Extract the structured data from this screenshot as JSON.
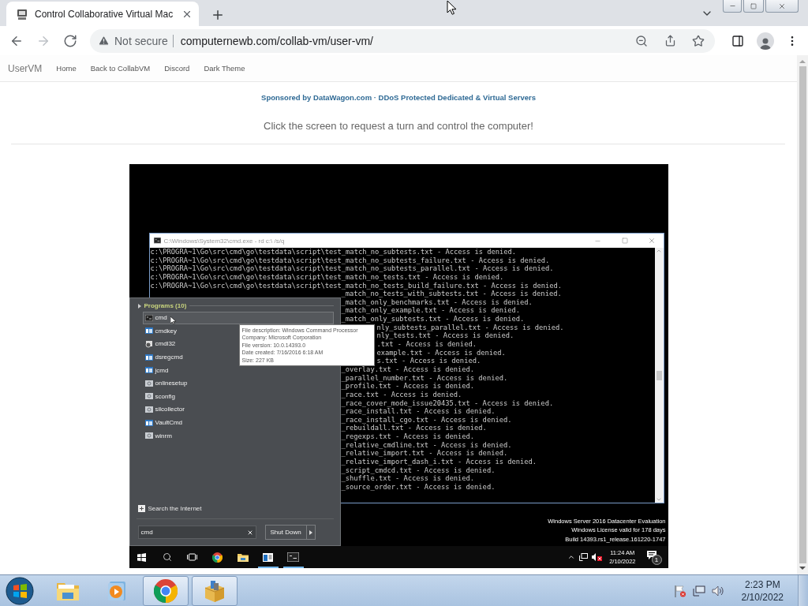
{
  "browser": {
    "tab": {
      "title": "Control Collaborative Virtual Mac",
      "selected": true
    },
    "nav_buttons": [
      {
        "kind": "back",
        "disabled": false
      },
      {
        "kind": "forward",
        "disabled": true
      },
      {
        "kind": "reload",
        "disabled": false
      }
    ],
    "address_bar": {
      "security": "Not secure",
      "url": "computernewb.com/collab-vm/user-vm/"
    }
  },
  "navbar": {
    "brand": "UserVM",
    "links": [
      "Home",
      "Back to CollabVM",
      "Discord",
      "Dark Theme"
    ]
  },
  "sponsor": "Sponsored by DataWagon.com · DDoS Protected Dedicated & Virtual Servers",
  "instruction": "Click the screen to request a turn and control the computer!",
  "vm": {
    "console_window": {
      "title": "C:\\Windows\\System32\\cmd.exe - rd  c:\\ /s/q",
      "lines": [
        {
          "text": "c:\\PROGRA~1\\Go\\src\\cmd\\go\\testdata\\script\\test_match_no_subtests.txt - Access is denied.",
          "kind": "full"
        },
        {
          "text": "c:\\PROGRA~1\\Go\\src\\cmd\\go\\testdata\\script\\test_match_no_subtests_failure.txt - Access is denied.",
          "kind": "full"
        },
        {
          "text": "c:\\PROGRA~1\\Go\\src\\cmd\\go\\testdata\\script\\test_match_no_subtests_parallel.txt - Access is denied.",
          "kind": "full"
        },
        {
          "text": "c:\\PROGRA~1\\Go\\src\\cmd\\go\\testdata\\script\\test_match_no_tests.txt - Access is denied.",
          "kind": "full"
        },
        {
          "text": "c:\\PROGRA~1\\Go\\src\\cmd\\go\\testdata\\script\\test_match_no_tests_build_failure.txt - Access is denied.",
          "kind": "full"
        },
        {
          "text": "_match_no_tests_with_subtests.txt - Access is denied.",
          "kind": "under_menu"
        },
        {
          "text": "_match_only_benchmarks.txt - Access is denied.",
          "kind": "under_menu"
        },
        {
          "text": "_match_only_example.txt - Access is denied.",
          "kind": "under_menu"
        },
        {
          "text": "_match_only_subtests.txt - Access is denied.",
          "kind": "under_menu"
        },
        {
          "text": "nly_subtests_parallel.txt - Access is denied.",
          "kind": "under_tooltip"
        },
        {
          "text": "nly_tests.txt - Access is denied.",
          "kind": "under_tooltip"
        },
        {
          "text": ".txt - Access is denied.",
          "kind": "under_tooltip"
        },
        {
          "text": "example.txt - Access is denied.",
          "kind": "under_tooltip"
        },
        {
          "text": "s.txt - Access is denied.",
          "kind": "under_tooltip"
        },
        {
          "text": "_overlay.txt - Access is denied.",
          "kind": "under_menu"
        },
        {
          "text": "_parallel_number.txt - Access is denied.",
          "kind": "under_menu"
        },
        {
          "text": "_profile.txt - Access is denied.",
          "kind": "under_menu"
        },
        {
          "text": "_race.txt - Access is denied.",
          "kind": "under_menu"
        },
        {
          "text": "_race_cover_mode_issue20435.txt - Access is denied.",
          "kind": "under_menu"
        },
        {
          "text": "_race_install.txt - Access is denied.",
          "kind": "under_menu"
        },
        {
          "text": "_race_install_cgo.txt - Access is denied.",
          "kind": "under_menu"
        },
        {
          "text": "_rebuildall.txt - Access is denied.",
          "kind": "under_menu"
        },
        {
          "text": "_regexps.txt - Access is denied.",
          "kind": "under_menu"
        },
        {
          "text": "_relative_cmdline.txt - Access is denied.",
          "kind": "under_menu"
        },
        {
          "text": "_relative_import.txt - Access is denied.",
          "kind": "under_menu"
        },
        {
          "text": "_relative_import_dash_i.txt - Access is denied.",
          "kind": "under_menu"
        },
        {
          "text": "_script_cmdcd.txt - Access is denied.",
          "kind": "under_menu"
        },
        {
          "text": "_shuffle.txt - Access is denied.",
          "kind": "under_menu"
        },
        {
          "text": "_source_order.txt - Access is denied.",
          "kind": "under_menu"
        }
      ]
    },
    "start_menu": {
      "group": "Programs (10)",
      "items": [
        {
          "label": "cmd",
          "kind": "console",
          "selected": true
        },
        {
          "label": "cmdkey",
          "kind": "app",
          "selected": false
        },
        {
          "label": "cmdl32",
          "kind": "setup",
          "selected": false
        },
        {
          "label": "dsregcmd",
          "kind": "app",
          "selected": false
        },
        {
          "label": "jcmd",
          "kind": "app",
          "selected": false
        },
        {
          "label": "onlinesetup",
          "kind": "script",
          "selected": false
        },
        {
          "label": "sconfig",
          "kind": "script",
          "selected": false
        },
        {
          "label": "silcollector",
          "kind": "script",
          "selected": false
        },
        {
          "label": "VaultCmd",
          "kind": "app",
          "selected": false
        },
        {
          "label": "winrm",
          "kind": "script",
          "selected": false
        }
      ],
      "web_search": "Search the Internet",
      "search": {
        "value": "cmd"
      },
      "power_button": "Shut Down"
    },
    "tooltip": [
      "File description: Windows Command Processor",
      "Company: Microsoft Corporation",
      "File version: 10.0.14393.0",
      "Date created: 7/16/2016 6:18 AM",
      "Size: 227 KB"
    ],
    "evaluation_notice": [
      "Windows Server 2016 Datacenter Evaluation",
      "Windows License valid for 178 days",
      "Build 14393.rs1_release.161220-1747"
    ],
    "taskbar": {
      "apps": [
        {
          "kind": "start",
          "running": false
        },
        {
          "kind": "search",
          "running": false
        },
        {
          "kind": "taskview",
          "running": false
        },
        {
          "kind": "chrome",
          "running": false
        },
        {
          "kind": "explorer",
          "running": false
        },
        {
          "kind": "server",
          "running": true
        },
        {
          "kind": "console",
          "running": true
        }
      ],
      "volume_muted": true,
      "clock": {
        "time": "11:24 AM",
        "date": "2/10/2022"
      },
      "notifications": "1"
    }
  },
  "host_taskbar": {
    "apps": [
      {
        "kind": "explorer",
        "running": false
      },
      {
        "kind": "media",
        "running": false
      },
      {
        "kind": "chrome",
        "running": true
      },
      {
        "kind": "package",
        "running": true
      }
    ],
    "clock": {
      "time": "2:23 PM",
      "date": "2/10/2022"
    }
  }
}
